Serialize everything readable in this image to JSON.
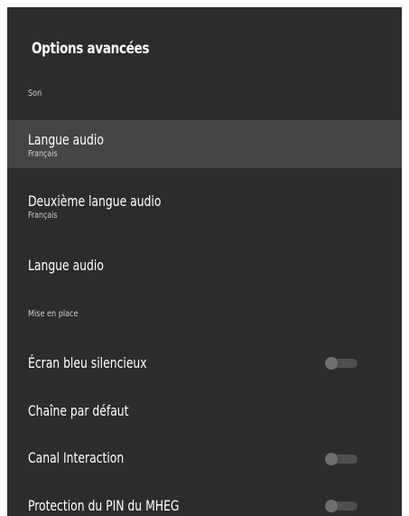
{
  "header": {
    "title": "Options avancées"
  },
  "sections": {
    "son": "Son",
    "mise_en_place": "Mise en place"
  },
  "items": [
    {
      "label": "Langue audio",
      "sub": "Français",
      "selected": true
    },
    {
      "label": "Deuxième langue audio",
      "sub": "Français"
    },
    {
      "label": "Langue audio"
    },
    {
      "label": "Écran bleu silencieux",
      "toggle": "off"
    },
    {
      "label": "Chaîne par défaut"
    },
    {
      "label": "Canal Interaction",
      "toggle": "off"
    },
    {
      "label": "Protection du PIN du MHEG",
      "toggle": "off"
    }
  ],
  "colors": {
    "panel_bg": "#2c2c2c",
    "selected_bg": "#444444",
    "text_primary": "#ffffff",
    "text_secondary": "#cfcfcf",
    "toggle_off_track": "#4f4f4f",
    "toggle_off_knob": "#707070"
  }
}
